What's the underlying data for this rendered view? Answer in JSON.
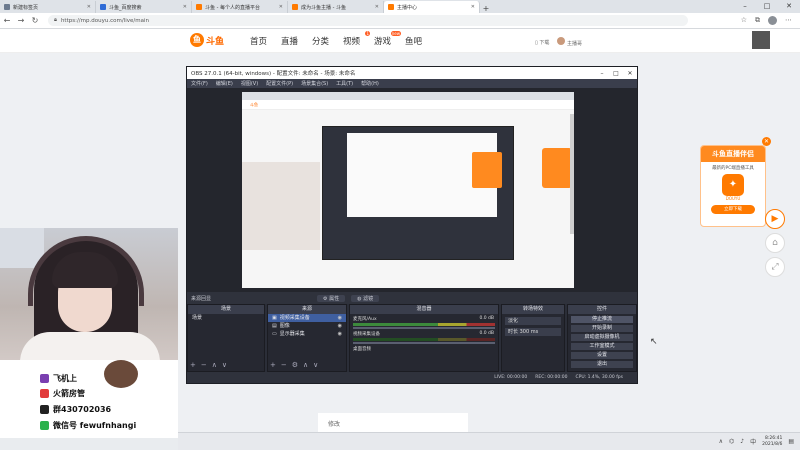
{
  "browser": {
    "tabs": [
      {
        "title": "新建标签页",
        "color": "#6d7b8f",
        "active": false
      },
      {
        "title": "斗鱼_百度搜索",
        "color": "#2f6bd6",
        "active": false
      },
      {
        "title": "斗鱼 - 每个人的直播平台",
        "color": "#ff7a00",
        "active": false
      },
      {
        "title": "成为斗鱼主播 - 斗鱼",
        "color": "#ff7a00",
        "active": false
      },
      {
        "title": "主播中心",
        "color": "#ff7a00",
        "active": true
      }
    ],
    "url": "https://mp.douyu.com/live/main"
  },
  "site": {
    "logo_text": "斗鱼",
    "nav": [
      "首页",
      "直播",
      "分类",
      "视频",
      "游戏",
      "鱼吧"
    ],
    "nav_badge_video": "1",
    "nav_badge_game": "new",
    "download_label": "下载",
    "user_label": "主播哥"
  },
  "obs": {
    "title": "OBS 27.0.1 (64-bit, windows) - 配置文件: 未命名 - 场景: 未命名",
    "menu": [
      "文件(F)",
      "编辑(E)",
      "视图(V)",
      "配置文件(P)",
      "场景集合(S)",
      "工具(T)",
      "帮助(H)"
    ],
    "source_bar_label": "来源回显",
    "properties_label": "属性",
    "filters_label": "滤镜",
    "docks": {
      "scenes_title": "场景",
      "scene_item": "场景",
      "sources_title": "来源",
      "sources": [
        "视频采集设备",
        "图像",
        "显示器采集"
      ],
      "mixer_title": "混音器",
      "mixer_channels": [
        {
          "name": "麦克风/Aux",
          "db": "0.0 dB"
        },
        {
          "name": "视频采集设备",
          "db": "0.0 dB"
        },
        {
          "name": "桌面音频",
          "db": ""
        }
      ],
      "transitions_title": "转场特效",
      "transition_value": "淡化",
      "duration_label": "时长",
      "duration_value": "300 ms",
      "controls_title": "控件",
      "controls": [
        "停止推流",
        "开始录制",
        "启动虚拟摄像机",
        "工作室模式",
        "设置",
        "退出"
      ]
    },
    "status": {
      "live": "LIVE: 00:00:00",
      "rec": "REC: 00:00:00",
      "cpu": "CPU: 1.4%, 30.00 fps"
    }
  },
  "overlay": {
    "rows": [
      {
        "text": "飞机上",
        "color": "#7a3fb0"
      },
      {
        "text": "火箭房管",
        "color": "#e23b3b"
      },
      {
        "text": "群430702036",
        "color": "#222222"
      },
      {
        "text": "微信号 fewufnhangi",
        "color": "#2bb24c"
      }
    ]
  },
  "ad": {
    "title": "斗鱼直播伴侣",
    "subtitle": "最新的PC端直播工具",
    "icon_label": "DOUYU",
    "button": "立即下载"
  },
  "page": {
    "card_text": "修改"
  },
  "taskbar": {
    "time": "8:26:41",
    "date": "2021/8/6"
  },
  "colors": {
    "brand": "#ff7a00",
    "obs_bg": "#2b2e38"
  }
}
